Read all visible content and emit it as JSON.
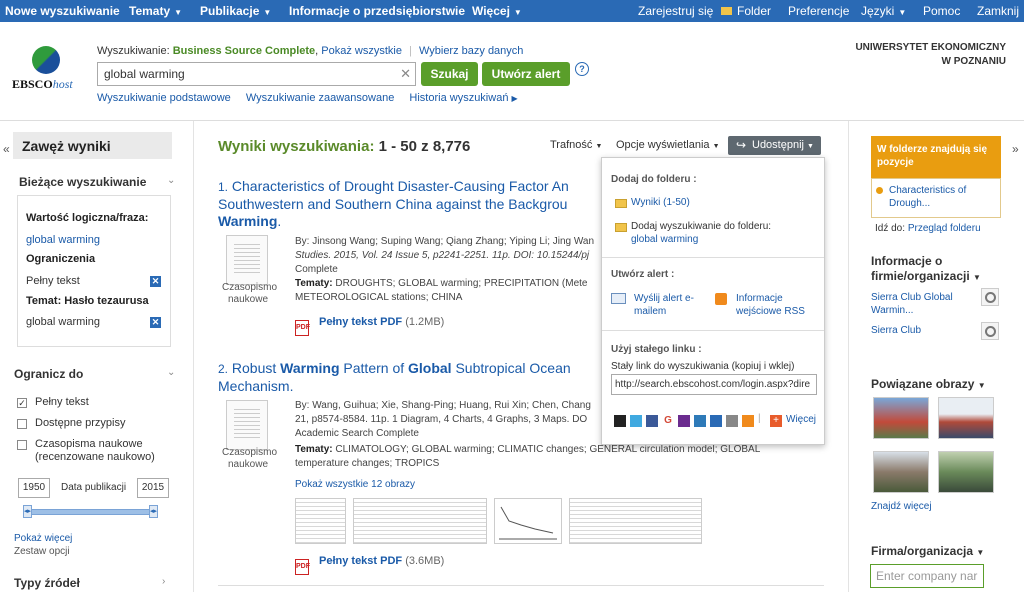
{
  "topnav": {
    "new_search": "Nowe wyszukiwanie",
    "subjects": "Tematy",
    "publications": "Publikacje",
    "company_info": "Informacje o przedsiębiorstwie",
    "more": "Więcej",
    "signin": "Zarejestruj się",
    "folder": "Folder",
    "preferences": "Preferencje",
    "languages": "Języki",
    "help": "Pomoc",
    "exit": "Zamknij"
  },
  "header": {
    "logo_main": "EBSCO",
    "logo_host": "host",
    "searching_label": "Wyszukiwanie:",
    "database": "Business Source Complete",
    "show_all": "Pokaż wszystkie",
    "choose_db": "Wybierz bazy danych",
    "query": "global warming",
    "search_btn": "Szukaj",
    "alert_btn": "Utwórz alert",
    "help_icon": "?",
    "basic_search": "Wyszukiwanie podstawowe",
    "advanced_search": "Wyszukiwanie zaawansowane",
    "history": "Historia wyszukiwań",
    "institution_line1": "UNIWERSYTET EKONOMICZNY",
    "institution_line2": "W POZNANIU"
  },
  "left": {
    "narrow": "Zawęż wyniki",
    "current_search": "Bieżące wyszukiwanie",
    "boolean_label": "Wartość logiczna/fraza:",
    "boolean_value": "global warming",
    "limiters_label": "Ograniczenia",
    "limiter_value": "Pełny tekst",
    "thesaurus_label": "Temat: Hasło tezaurusa",
    "thesaurus_value": "global warming",
    "limit_to": "Ogranicz do",
    "fulltext": "Pełny tekst",
    "available": "Dostępne przypisy",
    "scholarly_line1": "Czasopisma naukowe",
    "scholarly_line2": "(recenzowane naukowo)",
    "year_from": "1950",
    "pubdate_label": "Data publikacji",
    "year_to": "2015",
    "show_more": "Pokaż więcej",
    "options": "Zestaw opcji",
    "source_types": "Typy źródeł"
  },
  "results": {
    "label": "Wyniki wyszukiwania:",
    "range": "1 - 50 z 8,776",
    "relevance": "Trafność",
    "page_options": "Opcje wyświetlania",
    "share": "Udostępnij",
    "items": [
      {
        "num": "1.",
        "title_l1": "Characteristics of Drought Disaster-Causing Factor An",
        "title_l2": "Southwestern and Southern China against the Backgrou",
        "title_l3_bold": "Warming",
        "title_l3_rest": ".",
        "type_l1": "Czasopismo",
        "type_l2": "naukowe",
        "authors": "By: Jinsong Wang; Suping Wang; Qiang Zhang; Yiping Li; Jing Wan",
        "source": "Studies. 2015, Vol. 24 Issue 5, p2241-2251. 11p. DOI: 10.15244/pj",
        "db": "Complete",
        "subjects_label": "Tematy:",
        "subjects": "DROUGHTS; GLOBAL warming; PRECIPITATION (Mete",
        "subjects2": "METEOROLOGICAL stations; CHINA",
        "pdf": "Pełny tekst PDF",
        "pdf_size": "(1.2MB)"
      },
      {
        "num": "2.",
        "title_l1a": "Robust ",
        "title_l1b": "Warming",
        "title_l1c": " Pattern of ",
        "title_l1d": "Global",
        "title_l1e": " Subtropical Ocean",
        "title_l2": "Mechanism.",
        "type_l1": "Czasopismo",
        "type_l2": "naukowe",
        "authors": "By: Wang, Guihua; Xie, Shang-Ping; Huang, Rui Xin; Chen, Chang",
        "source": "21, p8574-8584. 11p. 1 Diagram, 4 Charts, 4 Graphs, 3 Maps. DO",
        "db": "Academic Search Complete",
        "subjects_label": "Tematy:",
        "subjects": "CLIMATOLOGY; GLOBAL warming; CLIMATIC changes; GENERAL circulation model; GLOBAL",
        "subjects2": "temperature changes; TROPICS",
        "images": "Pokaż wszystkie 12 obrazy",
        "pdf": "Pełny tekst PDF",
        "pdf_size": "(3.6MB)"
      }
    ]
  },
  "share_menu": {
    "add_folder": "Dodaj do folderu :",
    "results_range": "Wyniki (1-50)",
    "add_search_l1": "Dodaj wyszukiwanie do folderu:",
    "add_search_l2": "global warming",
    "create_alert": "Utwórz alert :",
    "email_l1": "Wyślij alert e-",
    "email_l2": "mailem",
    "rss_l1": "Informacje",
    "rss_l2": "wejściowe RSS",
    "permalink": "Użyj stałego linku :",
    "permalink_desc": "Stały link do wyszukiwania (kopiuj i wklej)",
    "permalink_url": "http://search.ebscohost.com/login.aspx?dire",
    "more": "Więcej"
  },
  "right": {
    "folder_title_l1": "W folderze znajdują się",
    "folder_title_l2": "pozycje",
    "folder_item_l1": "Characteristics of",
    "folder_item_l2": "Drough...",
    "goto": "Idź do:",
    "folder_view": "Przegląd folderu",
    "company_l1": "Informacje o",
    "company_l2": "firmie/organizacji",
    "sierra1_l1": "Sierra Club Global",
    "sierra1_l2": "Warmin...",
    "sierra2": "Sierra Club",
    "related_images": "Powiązane obrazy",
    "find_more": "Znajdź więcej",
    "company_org": "Firma/organizacja",
    "company_placeholder": "Enter company nar"
  },
  "colors": {
    "nav_blue": "#2a6ab5",
    "green": "#5a9e2a",
    "folder_orange": "#e99d10"
  }
}
